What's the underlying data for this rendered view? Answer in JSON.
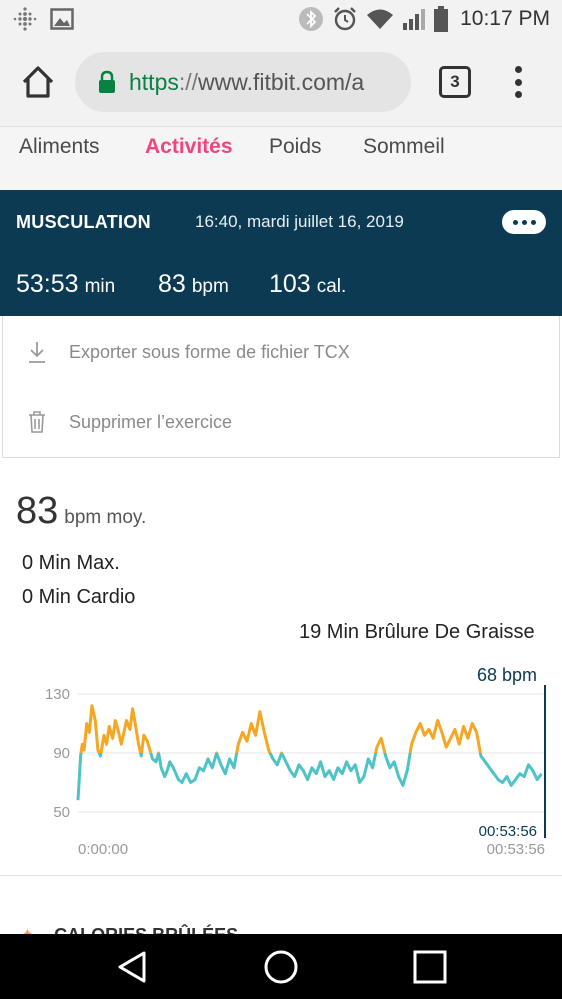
{
  "status_bar": {
    "time": "10:17 PM",
    "icons": [
      "fitbit-icon",
      "gallery-icon",
      "bluetooth-icon",
      "alarm-icon",
      "wifi-icon",
      "signal-icon",
      "battery-icon"
    ]
  },
  "browser": {
    "url_https": "https",
    "url_slashes": "://",
    "url_rest": "www.fitbit.com/a",
    "tab_count": "3"
  },
  "nav_tabs": [
    {
      "label": "Aliments",
      "active": false
    },
    {
      "label": "Activités",
      "active": true
    },
    {
      "label": "Poids",
      "active": false
    },
    {
      "label": "Sommeil",
      "active": false
    }
  ],
  "exercise": {
    "type": "MUSCULATION",
    "datetime": "16:40, mardi juillet 16, 2019",
    "duration_value": "53:53",
    "duration_unit": "min",
    "bpm_value": "83",
    "bpm_unit": "bpm",
    "cal_value": "103",
    "cal_unit": "cal."
  },
  "options": {
    "export_label": "Exporter sous forme de fichier TCX",
    "delete_label": "Supprimer l’exercice"
  },
  "summary": {
    "avg_value": "83",
    "avg_unit": "bpm moy.",
    "zone_max": "0 Min Max.",
    "zone_cardio": "0 Min Cardio",
    "zone_fat": "19 Min Brûlure De Graisse"
  },
  "next_section_title": "CALORIES BRÛLÉES",
  "chart_data": {
    "type": "line",
    "y_ticks": [
      "130",
      "90",
      "50"
    ],
    "ylim": [
      50,
      130
    ],
    "x_start_label": "0:00:00",
    "x_end_label": "00:53:56",
    "cursor_time": "00:53:56",
    "cursor_value": "68 bpm",
    "fat_burn_threshold": 90,
    "colors": {
      "normal": "#4ec3c7",
      "fat_burn": "#f5a623",
      "grid": "#e6e6e6",
      "cursor": "#0b3a52"
    },
    "x_minutes": [
      0,
      0.3,
      0.5,
      0.7,
      1,
      1.3,
      1.6,
      2,
      2.3,
      2.6,
      3,
      3.3,
      3.6,
      4,
      4.3,
      4.6,
      5,
      5.3,
      5.6,
      6,
      6.3,
      6.6,
      7,
      7.3,
      7.6,
      8,
      8.3,
      8.6,
      9,
      9.3,
      9.6,
      10,
      10.3,
      10.6,
      11,
      11.3,
      11.6,
      12,
      12.5,
      13,
      13.5,
      14,
      14.5,
      15,
      15.5,
      16,
      16.5,
      17,
      17.5,
      18,
      18.5,
      19,
      19.5,
      20,
      20.5,
      21,
      21.5,
      22,
      22.5,
      23,
      23.5,
      24,
      24.5,
      25,
      25.5,
      26,
      26.5,
      27,
      27.5,
      28,
      28.5,
      29,
      29.5,
      30,
      30.5,
      31,
      31.5,
      32,
      32.5,
      33,
      33.5,
      34,
      34.5,
      35,
      35.5,
      36,
      36.5,
      37,
      37.5,
      38,
      38.5,
      39,
      39.5,
      40,
      40.5,
      41,
      41.5,
      42,
      42.5,
      43,
      43.5,
      44,
      44.5,
      45,
      45.5,
      46,
      46.5,
      47,
      47.5,
      48,
      48.5,
      49,
      49.5,
      50,
      50.5,
      51,
      51.5,
      52,
      52.5,
      53,
      53.5,
      53.9
    ],
    "y_bpm": [
      58,
      88,
      96,
      92,
      110,
      104,
      122,
      112,
      92,
      88,
      102,
      96,
      108,
      100,
      112,
      106,
      96,
      104,
      112,
      106,
      120,
      110,
      96,
      88,
      102,
      98,
      92,
      86,
      84,
      90,
      80,
      74,
      78,
      84,
      80,
      76,
      72,
      70,
      76,
      70,
      72,
      80,
      78,
      86,
      80,
      90,
      82,
      76,
      86,
      80,
      96,
      104,
      98,
      110,
      102,
      118,
      104,
      92,
      86,
      82,
      90,
      84,
      78,
      74,
      82,
      78,
      72,
      80,
      76,
      84,
      74,
      78,
      72,
      80,
      76,
      84,
      78,
      82,
      70,
      74,
      86,
      80,
      94,
      100,
      88,
      80,
      84,
      74,
      68,
      78,
      96,
      104,
      110,
      102,
      106,
      100,
      112,
      104,
      94,
      100,
      106,
      96,
      108,
      100,
      110,
      104,
      88,
      84,
      80,
      76,
      72,
      70,
      74,
      68,
      72,
      76,
      74,
      82,
      78,
      72,
      76
    ]
  }
}
